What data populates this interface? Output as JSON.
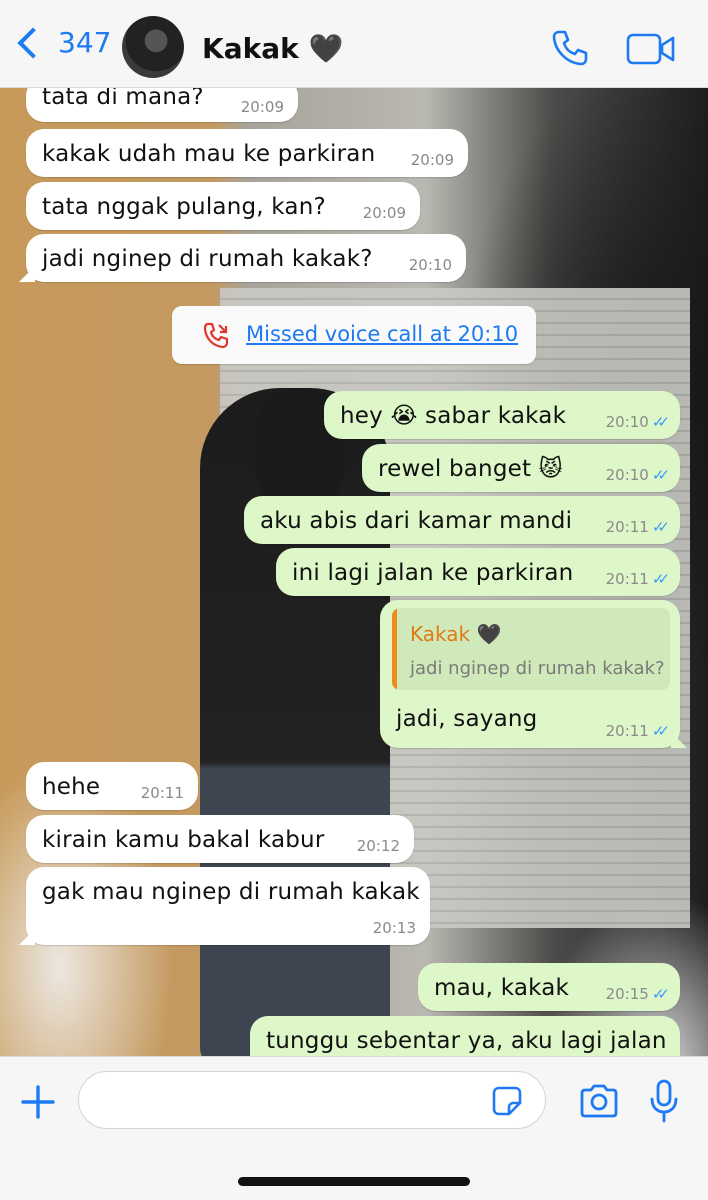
{
  "header": {
    "back_count": "347",
    "contact_name": "Kakak 🖤",
    "icons": [
      "chevron-left-icon",
      "phone-icon",
      "video-camera-icon"
    ],
    "accent_color": "#1d7af2"
  },
  "messages": [
    {
      "dir": "in",
      "text": "tata di mana?",
      "time": "20:09"
    },
    {
      "dir": "in",
      "text": "kakak udah mau ke parkiran",
      "time": "20:09"
    },
    {
      "dir": "in",
      "text": "tata nggak pulang, kan?",
      "time": "20:09"
    },
    {
      "dir": "in",
      "text": "jadi nginep di rumah kakak?",
      "time": "20:10"
    },
    {
      "dir": "system",
      "text": "Missed voice call at 20:10"
    },
    {
      "dir": "out",
      "text": "hey 😭 sabar kakak",
      "time": "20:10"
    },
    {
      "dir": "out",
      "text": "rewel banget 😾",
      "time": "20:10"
    },
    {
      "dir": "out",
      "text": "aku abis dari kamar mandi",
      "time": "20:11"
    },
    {
      "dir": "out",
      "text": "ini lagi jalan ke parkiran",
      "time": "20:11"
    },
    {
      "dir": "out",
      "text": "jadi, sayang",
      "time": "20:11",
      "reply": {
        "name": "Kakak 🖤",
        "text": "jadi nginep di rumah kakak?"
      }
    },
    {
      "dir": "in",
      "text": "hehe",
      "time": "20:11"
    },
    {
      "dir": "in",
      "text": "kirain kamu bakal kabur",
      "time": "20:12"
    },
    {
      "dir": "in",
      "text": "gak mau nginep di rumah kakak",
      "time": "20:13"
    },
    {
      "dir": "out",
      "text": "mau, kakak",
      "time": "20:15"
    },
    {
      "dir": "out",
      "text": "tunggu sebentar ya, aku lagi jalan",
      "time": ""
    }
  ],
  "composer": {
    "icons": [
      "plus-icon",
      "sticker-icon",
      "camera-icon",
      "microphone-icon"
    ]
  },
  "colors": {
    "outgoing_bubble": "#ddf7c8",
    "incoming_bubble": "#ffffff",
    "read_tick": "#3d9bf5",
    "missed_call": "#e0362c"
  }
}
